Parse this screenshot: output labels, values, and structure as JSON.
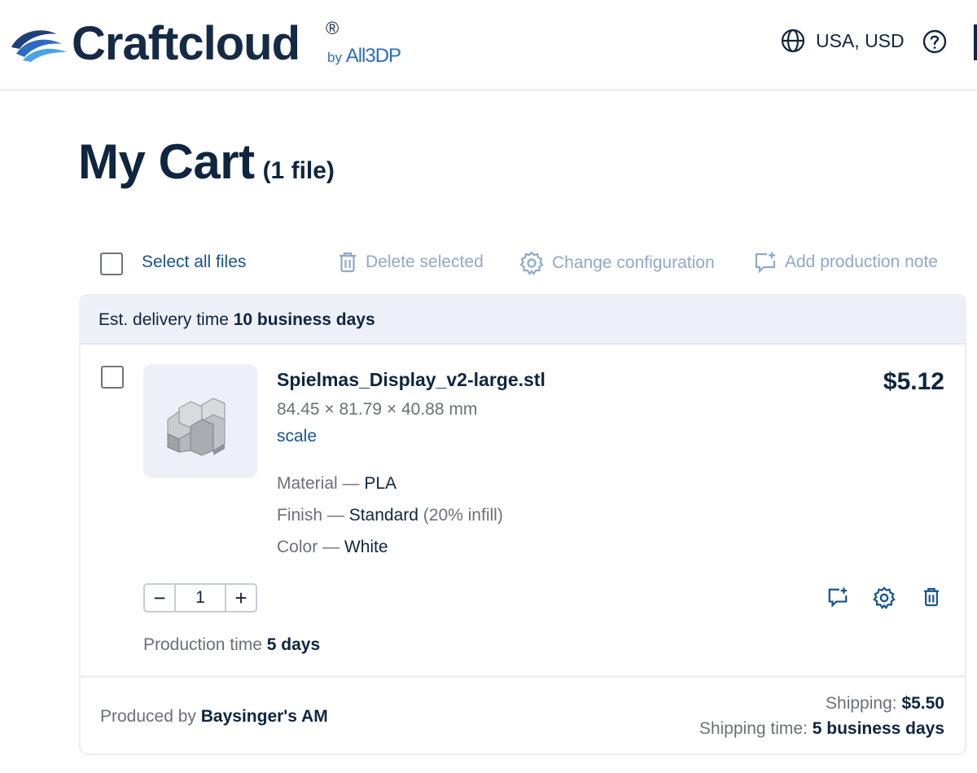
{
  "header": {
    "brand": "Craftcloud",
    "brand_reg": "®",
    "brand_by": "by",
    "brand_parent": "All3DP",
    "region_label": "USA, USD",
    "icons": {
      "region": "globe-icon",
      "help": "help-circle-icon"
    }
  },
  "page": {
    "title": "My Cart",
    "file_count": "(1 file)"
  },
  "toolbar": {
    "select_all": "Select all files",
    "delete_selected": "Delete selected",
    "change_configuration": "Change configuration",
    "add_production_note": "Add production note"
  },
  "order": {
    "delivery_prefix": "Est. delivery time",
    "delivery_value": "10 business days",
    "item": {
      "filename": "Spielmas_Display_v2-large.stl",
      "dimensions": "84.45 × 81.79 × 40.88 mm",
      "scale_link": "scale",
      "price": "$5.12",
      "material_label": "Material —",
      "material_value": "PLA",
      "finish_label": "Finish —",
      "finish_value": "Standard",
      "finish_note": "(20% infill)",
      "color_label": "Color —",
      "color_value": "White",
      "quantity": "1",
      "decrement": "−",
      "increment": "+",
      "production_prefix": "Production time",
      "production_value": "5 days"
    },
    "footer": {
      "produced_prefix": "Produced by",
      "producer": "Baysinger's AM",
      "shipping_prefix": "Shipping:",
      "shipping_value": "$5.50",
      "shipping_time_prefix": "Shipping time:",
      "shipping_time_value": "5 business days"
    }
  },
  "colors": {
    "text_dark": "#0f2540",
    "link_blue": "#15548f",
    "muted_blue": "#8fa9c8",
    "muted_gray": "#6b7079",
    "panel_bg": "#eef0f8"
  }
}
